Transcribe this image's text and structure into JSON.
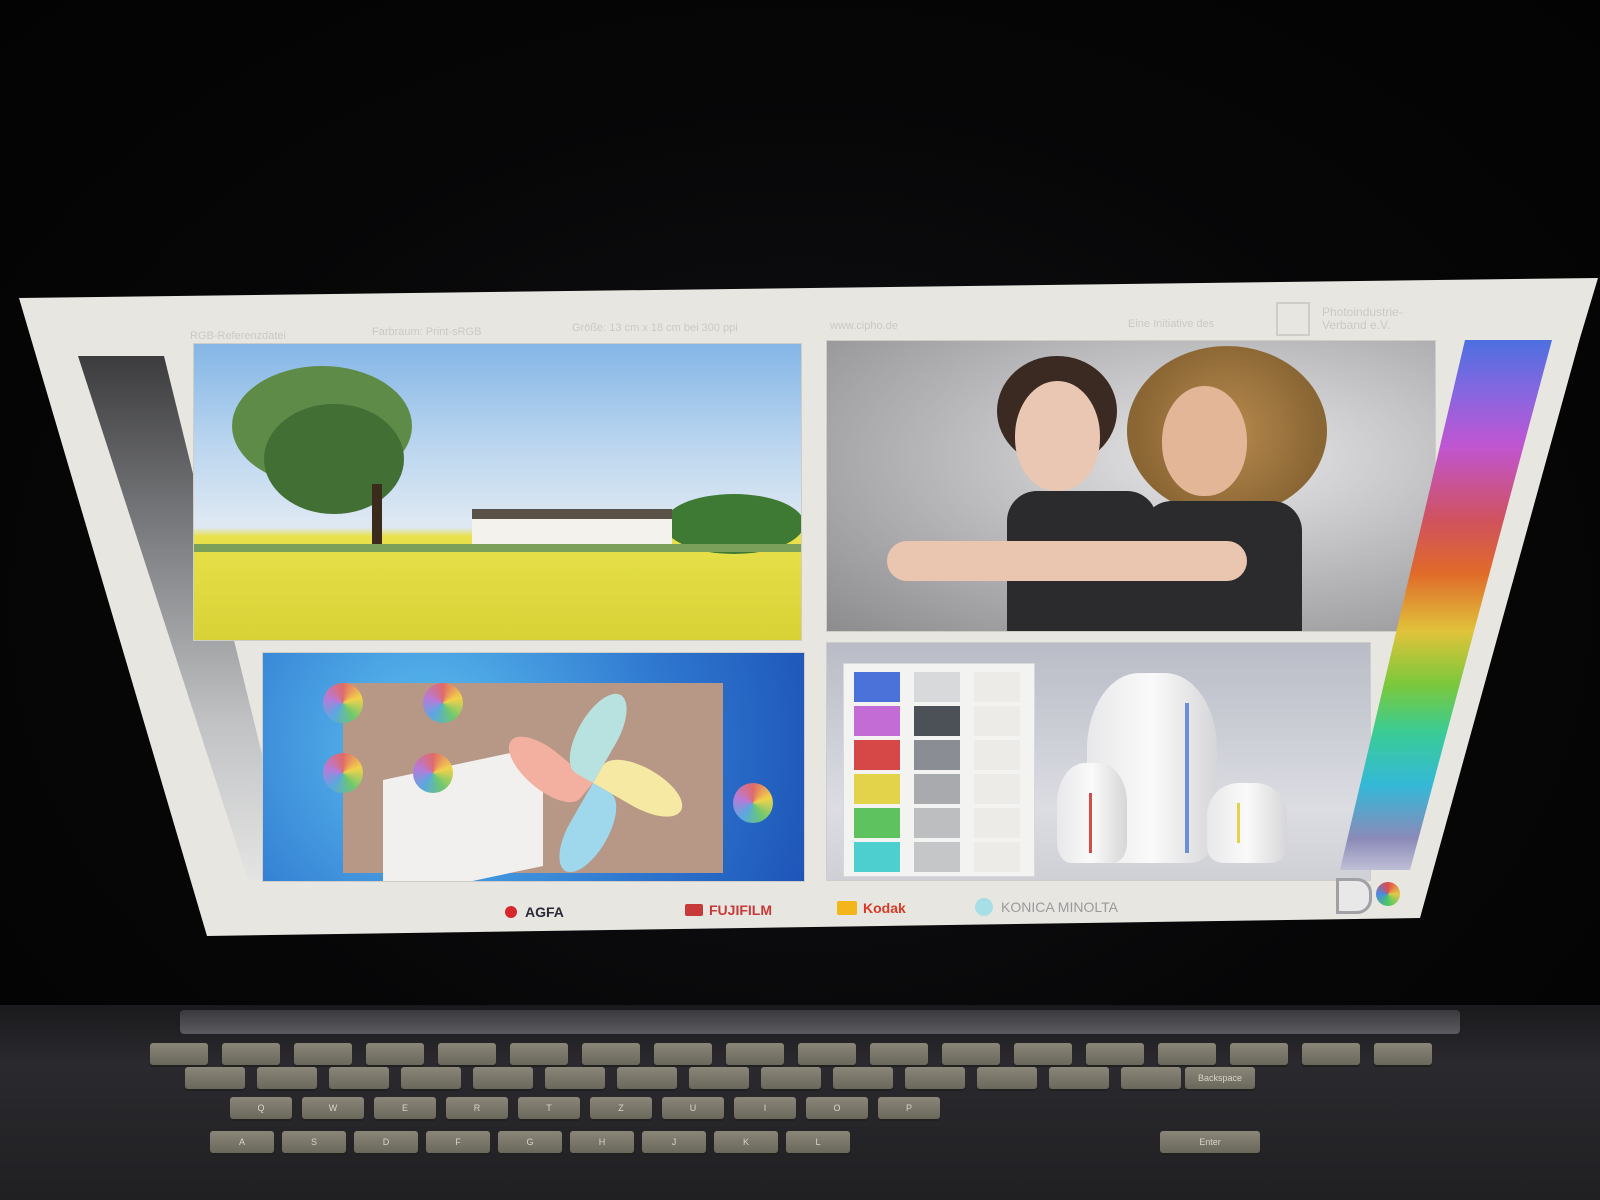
{
  "header": {
    "ref_label": "RGB-Referenzdatei",
    "colorspace_label": "Farbraum: Print-sRGB",
    "size_label": "Größe: 13 cm x 18 cm bei 300 ppi",
    "url": "www.cipho.de",
    "initiative_label": "Eine Initiative des",
    "association_name": "Photoindustrie-Verband e.V."
  },
  "logos": {
    "agfa": "AGFA",
    "fujifilm": "FUJIFILM",
    "kodak": "Kodak",
    "konica": "KONICA MINOLTA"
  },
  "colors": {
    "agfa": "#d8262e",
    "fujifilm": "#c83a3a",
    "kodak": "#d93b27",
    "konica": "#4ab8c8"
  },
  "color_patches": [
    "#4a72d8",
    "#c46cd6",
    "#d64848",
    "#e3d34a",
    "#5ec25e",
    "#4ecfcf"
  ],
  "gray_patches": [
    "#d8d9db",
    "#4c5158",
    "#8a8e94",
    "#a8aaae",
    "#bcbec0",
    "#c4c6c8"
  ],
  "keyboard": {
    "row1": [
      "Q",
      "W",
      "E",
      "R",
      "T",
      "Z",
      "U",
      "I",
      "O",
      "P"
    ],
    "row2": [
      "A",
      "S",
      "D",
      "F",
      "G",
      "H",
      "J",
      "K",
      "L"
    ],
    "backspace": "Backspace",
    "enter": "Enter"
  }
}
